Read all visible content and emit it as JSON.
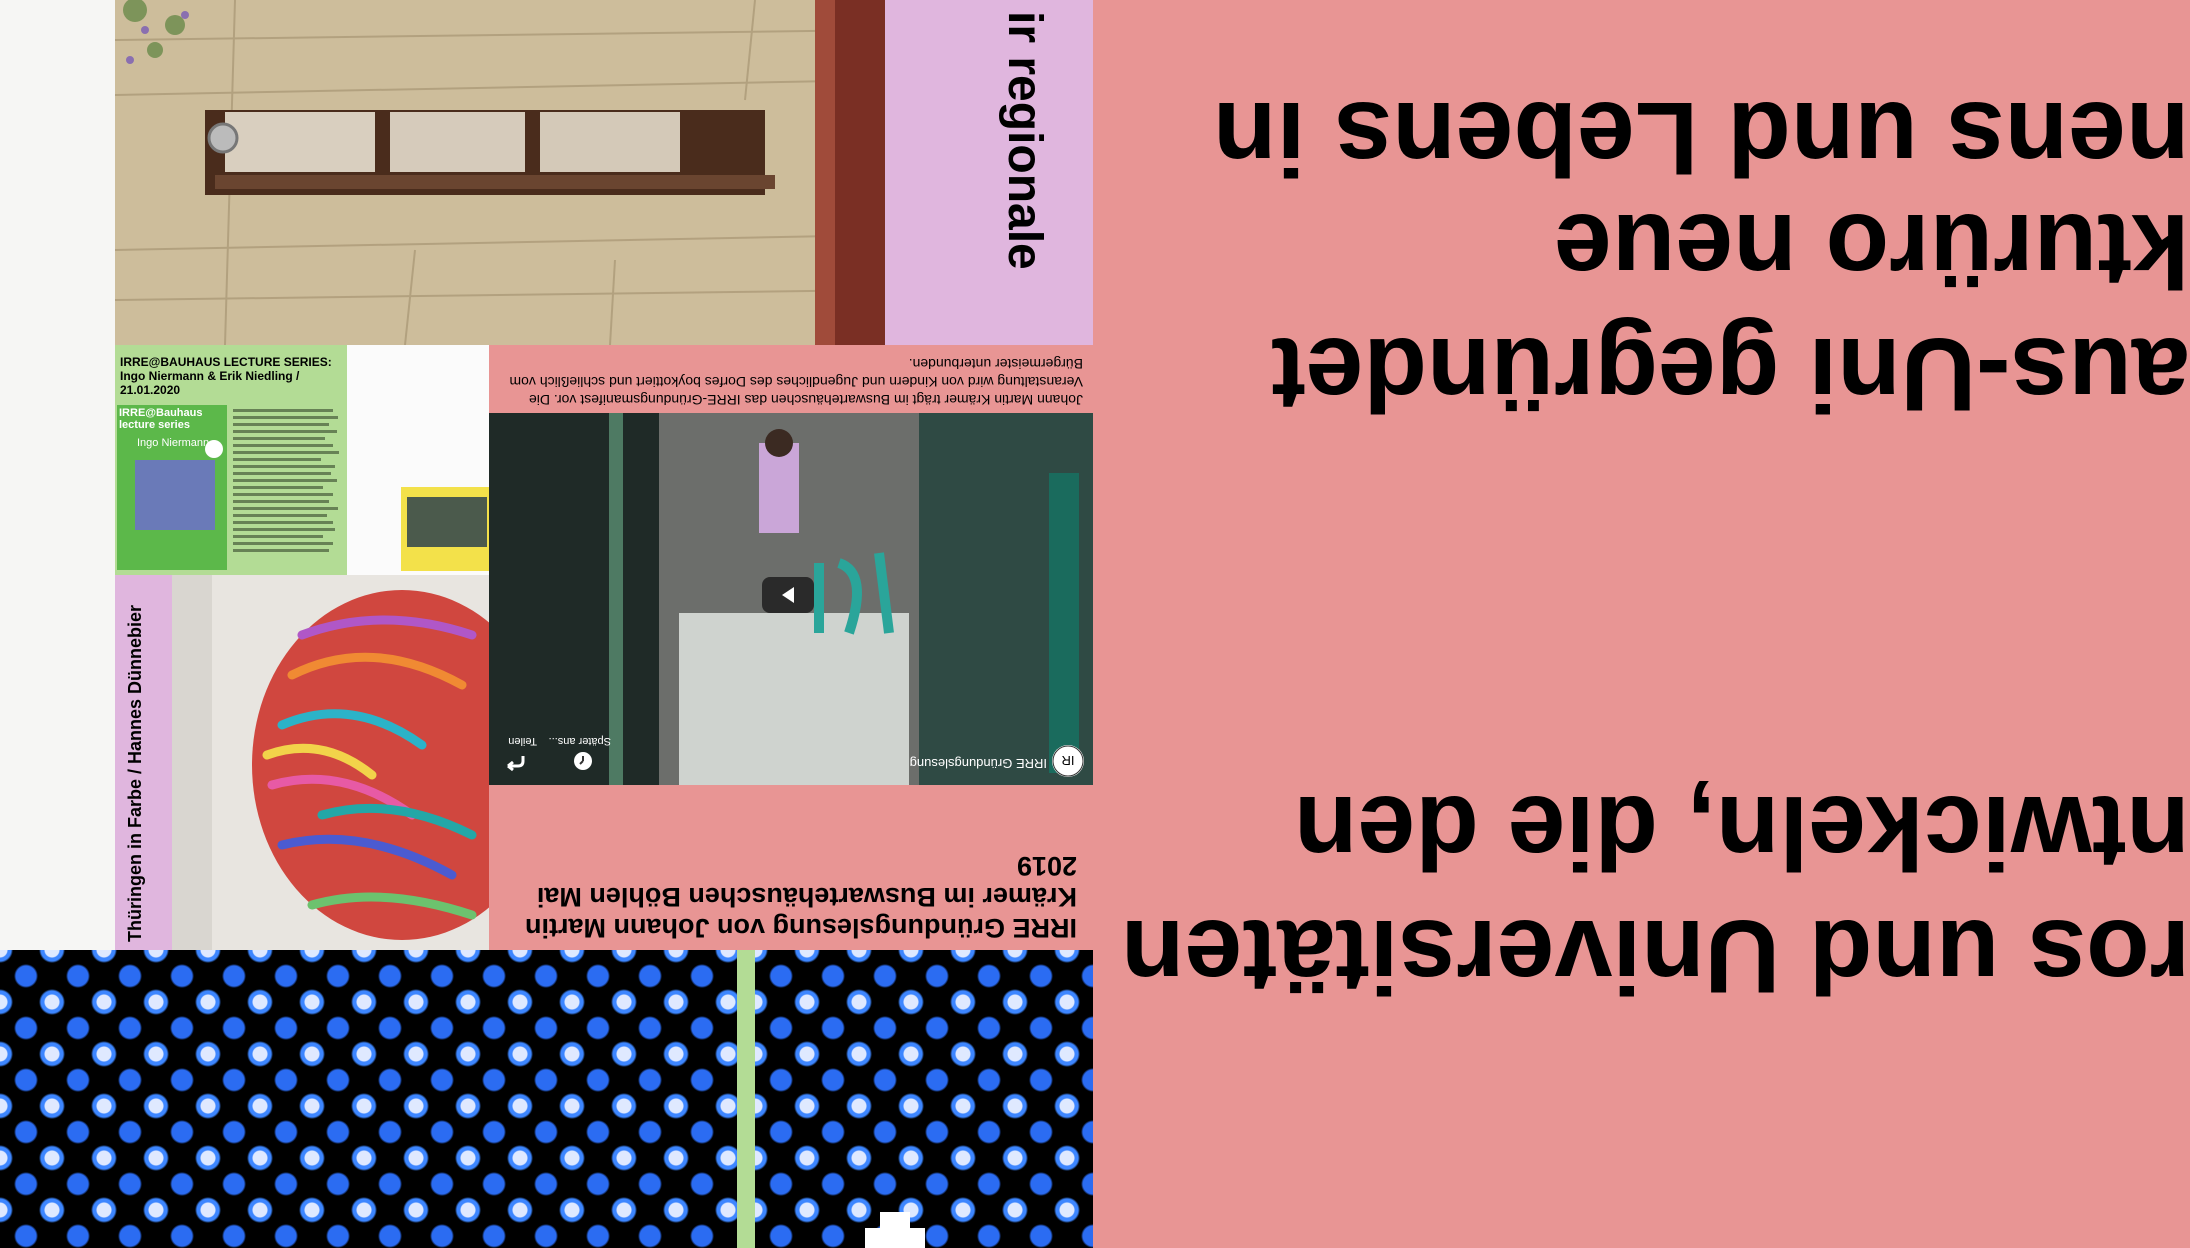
{
  "big_panel": {
    "lines": [
      "nens und Lebens in",
      "kturüro neue",
      "aus-Uni gegründet",
      "ntwickeln, die den",
      "ros und Universitäten"
    ]
  },
  "wall_tile": {
    "violet_text": "ir regionale"
  },
  "lecture_tile": {
    "title": "IRRE@BAUHAUS LECTURE SERIES: Ingo Niermann & Erik Niedling / 21.01.2020",
    "poster_title": "IRRE@Bauhaus lecture series",
    "poster_speaker": "Ingo Niermann"
  },
  "hair_tile": {
    "label": "Thüringen in Farbe / Hannes Dünnebier"
  },
  "event_tile": {
    "caption": "Johann Martin Krämer trägt im Buswartehäuschen das IRRE-Gründungsmanifest vor. Die Veranstaltung wird von Kindern und Jugendliches des Dorfes boykottiert und schließlich vom Bürgermeister unterbunden.",
    "headline": "IRRE Gründungslesung von Johann Martin Krämer im Buswartehäuschen Böhlen Mai 2019",
    "video": {
      "title": "IRRE Gründungslesung",
      "watch_later_label": "Später ans...",
      "share_label": "Teilen"
    }
  }
}
